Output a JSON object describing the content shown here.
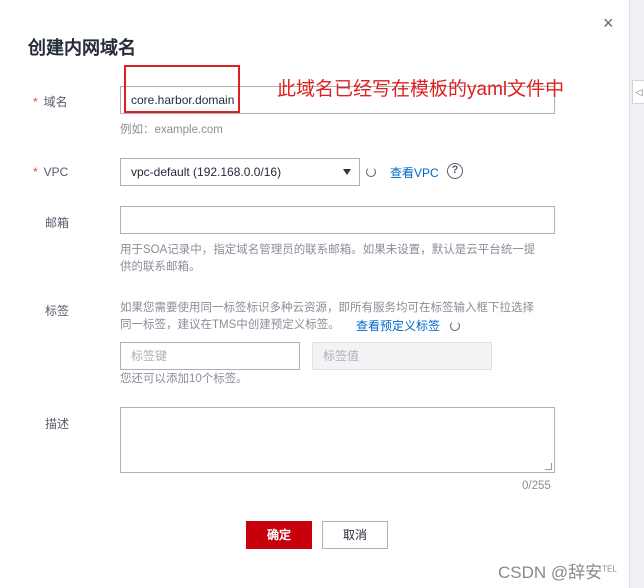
{
  "dialog": {
    "title": "创建内网域名",
    "close_glyph": "×"
  },
  "form": {
    "domain": {
      "required_mark": "*",
      "label": "域名",
      "value": "core.harbor.domain",
      "hint": "例如：example.com"
    },
    "vpc": {
      "required_mark": "*",
      "label": "VPC",
      "selected": "vpc-default (192.168.0.0/16)",
      "view_link": "查看VPC",
      "help_glyph": "?"
    },
    "email": {
      "label": "邮箱",
      "value": "",
      "hint_line1": "用于SOA记录中，指定域名管理员的联系邮箱。如果未设置，默认是云平台统一提",
      "hint_line2": "供的联系邮箱。"
    },
    "tags": {
      "label": "标签",
      "hint_line1": "如果您需要使用同一标签标识多种云资源，即所有服务均可在标签输入框下拉选择",
      "hint_line2": "同一标签，建议在TMS中创建预定义标签。",
      "predefined_link": "查看预定义标签",
      "key_placeholder": "标签键",
      "value_placeholder": "标签值",
      "remaining_hint": "您还可以添加10个标签。"
    },
    "description": {
      "label": "描述",
      "value": "",
      "counter": "0/255"
    }
  },
  "buttons": {
    "confirm": "确定",
    "cancel": "取消"
  },
  "annotation": {
    "text": "此域名已经写在模板的yaml文件中",
    "color": "#e02020"
  },
  "watermark": {
    "text": "CSDN @辞安",
    "suffix": "TEL"
  },
  "colors": {
    "primary": "#c7000b",
    "link": "#0066cc",
    "required": "#e54545"
  }
}
